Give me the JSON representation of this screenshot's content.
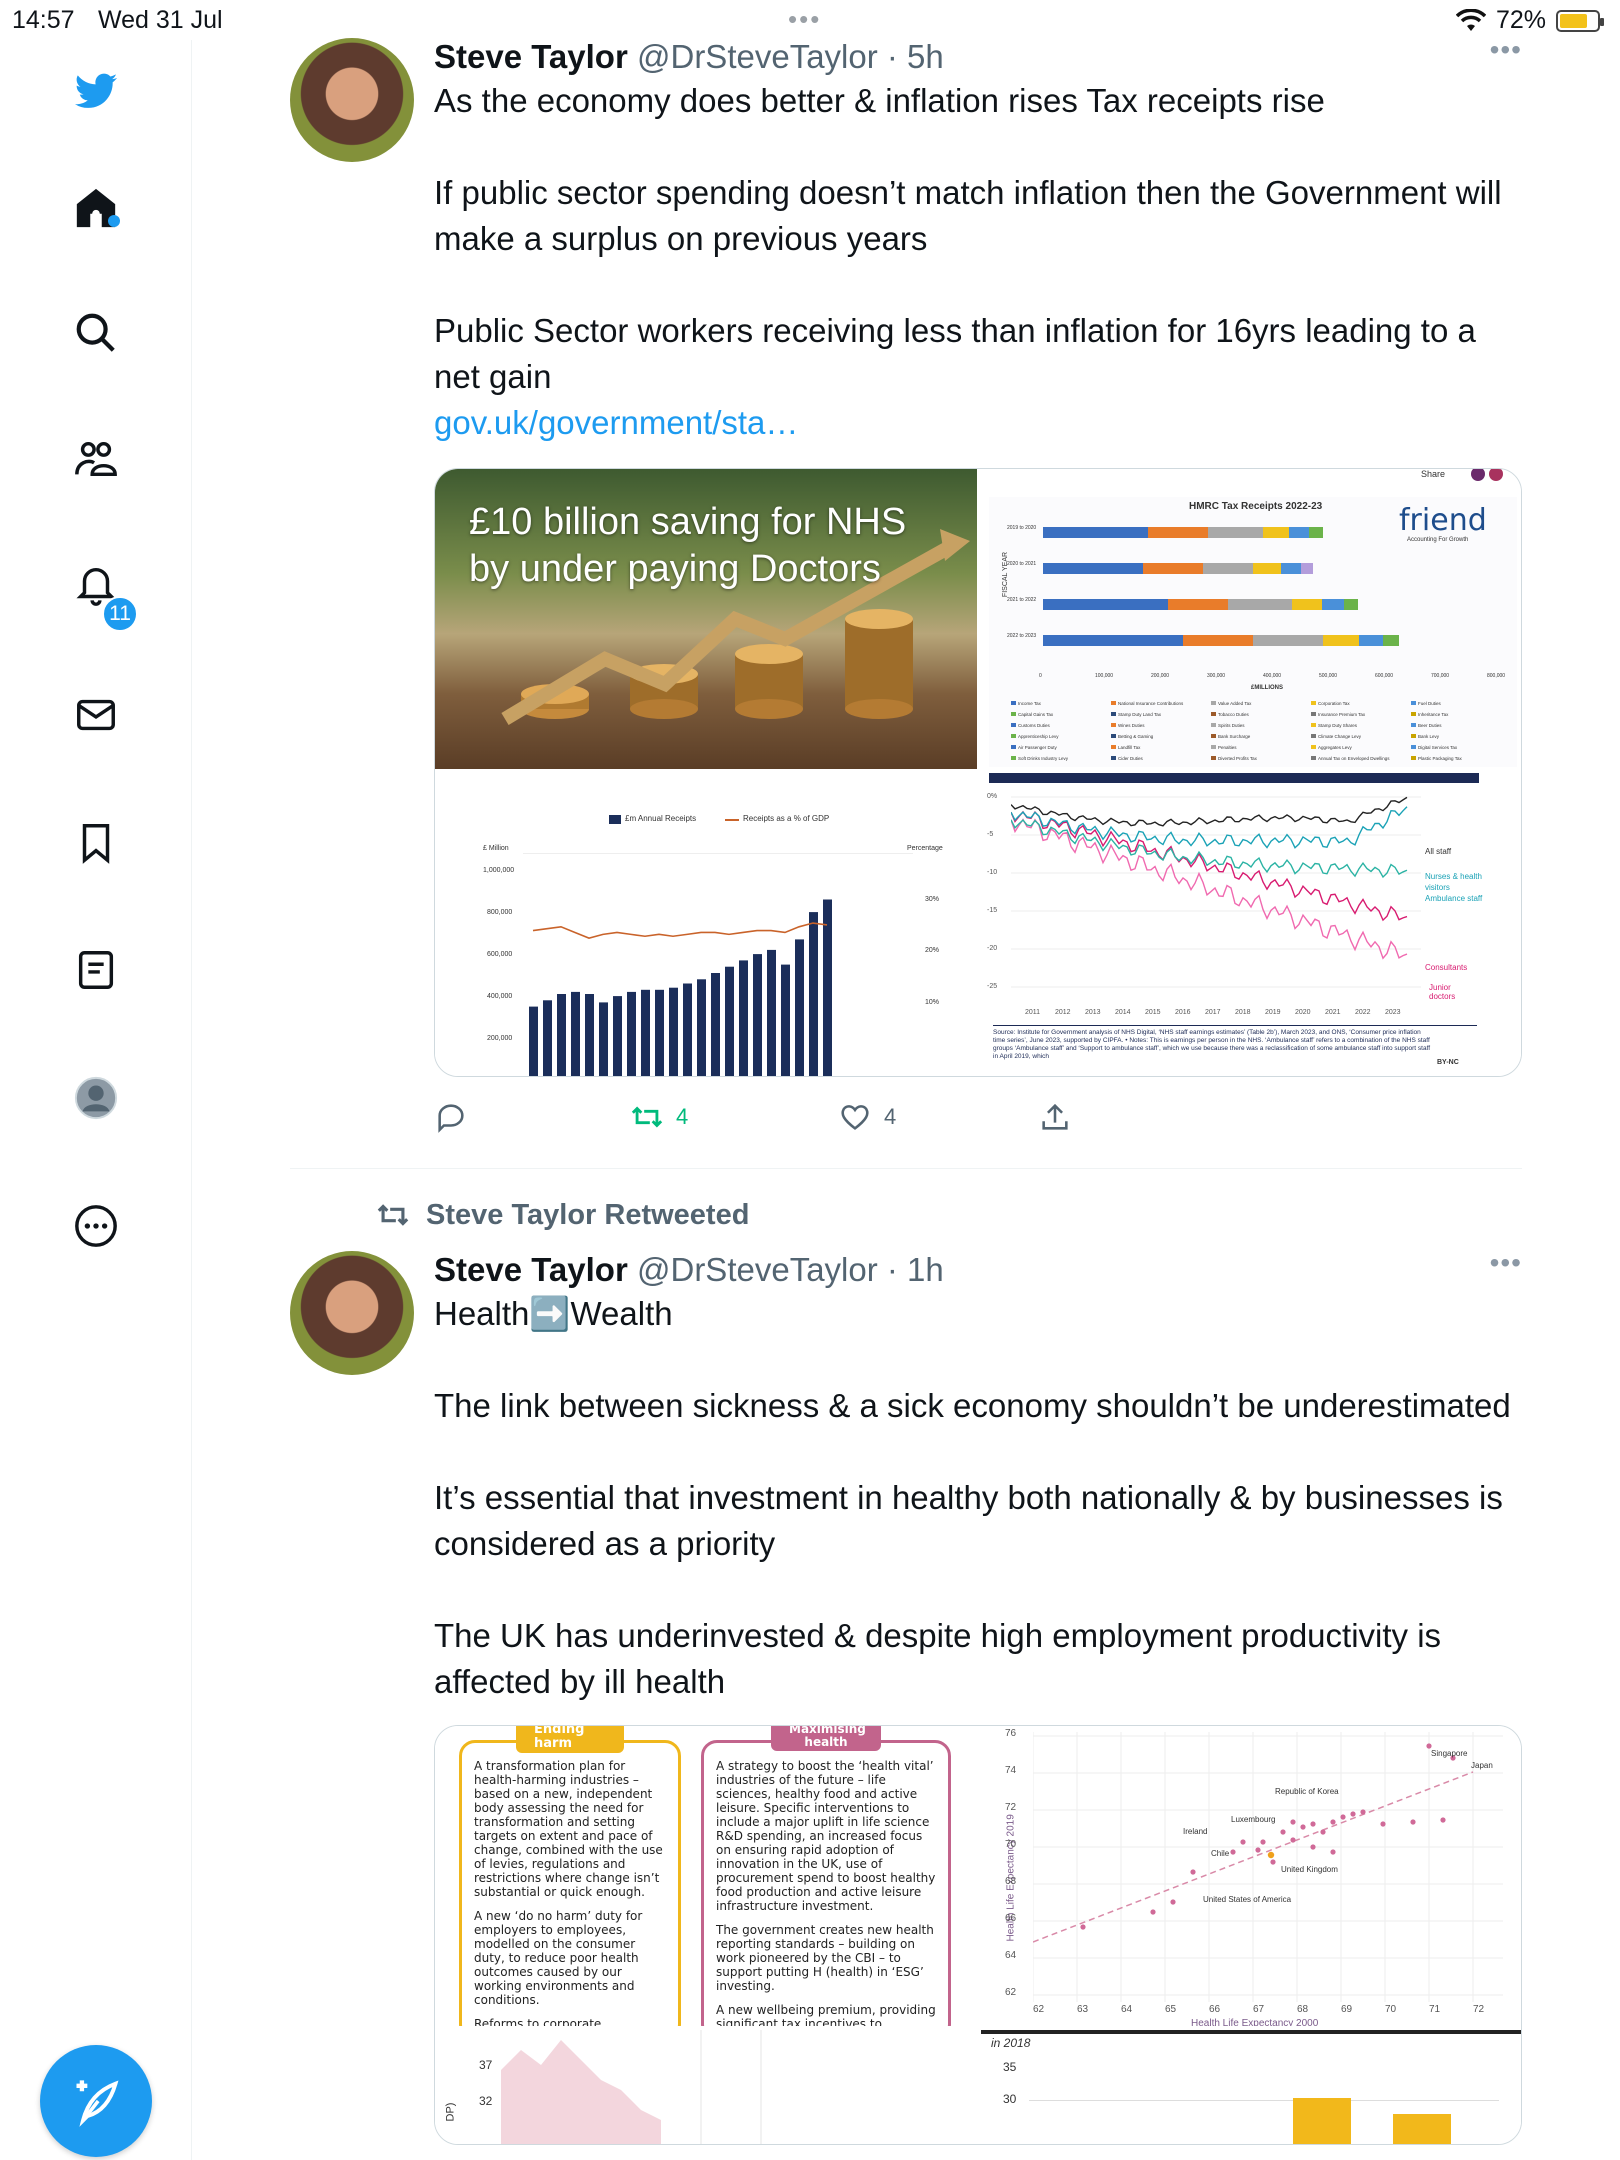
{
  "status_bar": {
    "time": "14:57",
    "date": "Wed 31 Jul",
    "battery": "72%"
  },
  "nav": {
    "notifications_badge": "11"
  },
  "tweet1": {
    "name": "Steve Taylor",
    "handle": "@DrSteveTaylor",
    "age": "· 5h",
    "paragraphs": [
      "As the economy does better & inflation rises Tax receipts rise",
      "",
      "If public sector spending doesn’t match inflation then the Government will make a surplus on previous years",
      "",
      "Public Sector workers receiving less than inflation for 16yrs leading to a net gain"
    ],
    "link": "gov.uk/government/sta…",
    "replies": "",
    "retweets": "4",
    "likes": "4",
    "media": {
      "panel1_title": "£10 billion saving for NHS by under paying Doctors",
      "panel2": {
        "title": "HMRC Tax Receipts 2022-23",
        "brand": "friend",
        "brand_sub": "Accounting For Growth",
        "share": "Share",
        "ylabel": "FISCAL YEAR",
        "xlabel": "£MILLIONS",
        "years": [
          "2019 to 2020",
          "2020 to 2021",
          "2021 to 2022",
          "2022 to 2023"
        ],
        "x_ticks": [
          "0",
          "100,000",
          "200,000",
          "300,000",
          "400,000",
          "500,000",
          "600,000",
          "700,000",
          "800,000"
        ],
        "legend": [
          "Income Tax",
          "National Insurance Contributions",
          "Value Added Tax",
          "Corporation Tax",
          "Fuel Duties",
          "Capital Gains Tax",
          "Stamp Duty Land Tax",
          "Tobacco Duties",
          "Insurance Premium Tax",
          "Inheritance Tax",
          "Customs Duties",
          "Wines Duties",
          "Spirits Duties",
          "Stamp Duty Shares",
          "Beer Duties",
          "Apprenticeship Levy",
          "Betting & Gaming",
          "Bank Surcharge",
          "Climate Change Levy",
          "Bank Levy",
          "Air Passenger Duty",
          "Landfill Tax",
          "Penalties",
          "Aggregates Levy",
          "Digital Services Tax",
          "Soft Drinks Industry Levy",
          "Cider Duties",
          "Diverted Profits Tax",
          "Annual Tax on Enveloped Dwellings",
          "Plastic Packaging Tax"
        ]
      },
      "panel3": {
        "legend_bar": "£m Annual Receipts",
        "legend_line": "Receipts as a % of GDP",
        "left_title": "£ Million",
        "right_title": "Percentage",
        "left_ticks": [
          "1,000,000",
          "800,000",
          "600,000",
          "400,000",
          "200,000"
        ],
        "right_ticks": [
          "30%",
          "20%",
          "10%"
        ]
      },
      "panel4": {
        "y_ticks": [
          "0%",
          "-5",
          "-10",
          "-15",
          "-20",
          "-25"
        ],
        "x_ticks": [
          "2011",
          "2012",
          "2013",
          "2014",
          "2015",
          "2016",
          "2017",
          "2018",
          "2019",
          "2020",
          "2021",
          "2022",
          "2023"
        ],
        "labels": [
          "All staff",
          "Nurses & health visitors Ambulance staff",
          "Consultants",
          "Junior doctors"
        ],
        "source": "Source: Institute for Government analysis of NHS Digital, ‘NHS staff earnings estimates’ (Table 2b’), March 2023, and ONS, ‘Consumer price inflation time series’, June 2023, supported by CIPFA. • Notes: This is earnings per person in the NHS. ‘Ambulance staff’ refers to a combination of the NHS staff groups ‘Ambulance staff’ and ‘Support to ambulance staff’, which we use because there was a reclassification of some ambulance staff into support staff in April 2019, which",
        "license": "BY-NC"
      }
    }
  },
  "retweet_banner": "Steve Taylor Retweeted",
  "tweet2": {
    "name": "Steve Taylor",
    "handle": "@DrSteveTaylor",
    "age": "· 1h",
    "paragraphs": [
      "Health➡️Wealth",
      "",
      "The link between sickness & a sick economy shouldn’t be underestimated",
      "",
      "It’s essential that investment in healthy both nationally & by businesses is considered as a priority",
      "",
      "The UK has underinvested & despite high employment productivity is affected by ill health"
    ],
    "media": {
      "box1_tab": "Ending harm",
      "box1": [
        "A transformation plan for health-harming industries – based on a new, independent body assessing the need for transformation and setting targets on extent and pace of change, combined with the use of levies, regulations and restrictions where change isn’t substantial or quick enough.",
        "A new ‘do no harm’ duty for employers to employees, modelled on the consumer duty, to reduce poor health outcomes caused by our working environments and conditions.",
        "Reforms to corporate governance to help business focus on long-term stakeholder outcomes, not just short-term shareholder interests."
      ],
      "box2_tab": "Maximising health",
      "box2": [
        "A strategy to boost the ‘health vital’ industries of the future – life sciences, healthy food and active leisure. Specific interventions to include a major uplift in life science R&D spending, an increased focus on ensuring rapid adoption of innovation in the UK, use of procurement spend to boost healthy food production and active leisure infrastructure investment.",
        "The government creates new health reporting standards – building on work pioneered by the CBI – to support putting H (health) in ‘ESG’ investing.",
        "A new wellbeing premium, providing significant tax incentives to companies creating the healthiest workplaces – building on the success of the Wellbeing"
      ],
      "scatter": {
        "ylabel": "Health Life Expectancy 2019",
        "xlabel": "Health Life Expectancy 2000",
        "y_ticks": [
          "76",
          "74",
          "72",
          "70",
          "68",
          "66",
          "64",
          "62"
        ],
        "x_ticks": [
          "62",
          "63",
          "64",
          "65",
          "66",
          "67",
          "68",
          "69",
          "70",
          "71",
          "72"
        ],
        "labels": [
          "Singapore",
          "Japan",
          "Republic of Korea",
          "Luxembourg",
          "Ireland",
          "Chile",
          "United Kingdom",
          "United States of America"
        ]
      },
      "bottom_left_ticks": [
        "37",
        "32"
      ],
      "bottom_left_label": "DP)",
      "bottom_right_caption": "in 2018",
      "bottom_right_ticks": [
        "35",
        "30"
      ]
    }
  }
}
